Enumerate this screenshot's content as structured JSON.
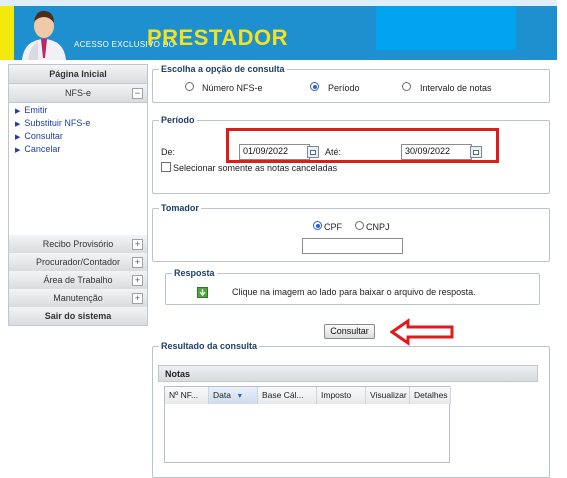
{
  "header": {
    "sub_title": "ACESSO EXCLUSIVO DO",
    "main_title": "PRESTADOR"
  },
  "sidebar": {
    "home": "Página Inicial",
    "nfse_section": "NFS-e",
    "items": [
      "Emitir",
      "Substituir NFS-e",
      "Consultar",
      "Cancelar"
    ],
    "groups": [
      "Recibo Provisório",
      "Procurador/Contador",
      "Área de Trabalho",
      "Manutenção"
    ],
    "logout": "Sair do sistema",
    "plus": "+",
    "minus": "−"
  },
  "consulta": {
    "legend": "Escolha a opção de consulta",
    "options": [
      "Número NFS-e",
      "Período",
      "Intervalo de notas"
    ],
    "selected": "Período"
  },
  "periodo": {
    "legend": "Período",
    "de_label": "De:",
    "de_value": "01/09/2022",
    "ate_label": "Até:",
    "ate_value": "30/09/2022",
    "checkbox_label": "Selecionar somente as notas canceladas"
  },
  "tomador": {
    "legend": "Tomador",
    "options": [
      "CPF",
      "CNPJ"
    ],
    "selected": "CPF",
    "value": ""
  },
  "resposta": {
    "legend": "Resposta",
    "text": "Clique na imagem ao lado para baixar o arquivo de resposta."
  },
  "actions": {
    "consultar": "Consultar"
  },
  "resultado": {
    "legend": "Resultado da consulta",
    "table_title": "Notas",
    "columns": [
      "Nº NF...",
      "Data",
      "Base Cál...",
      "Imposto",
      "Visualizar",
      "Detalhes"
    ]
  },
  "colors": {
    "header_blue": "#1e8fcf",
    "title_yellow": "#f4e21e",
    "highlight_red": "#e01b1b"
  }
}
